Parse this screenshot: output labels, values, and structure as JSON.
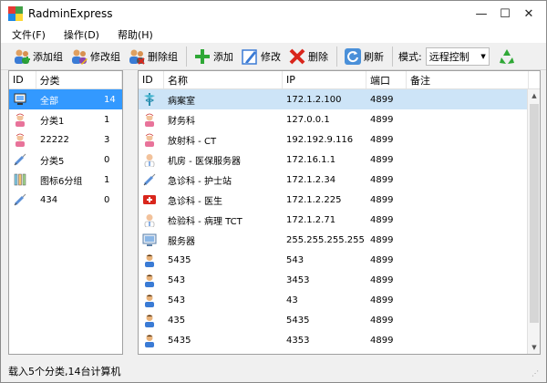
{
  "window": {
    "title": "RadminExpress"
  },
  "menu": [
    "文件(F)",
    "操作(D)",
    "帮助(H)"
  ],
  "toolbar": {
    "add_group": "添加组",
    "edit_group": "修改组",
    "delete_group": "删除组",
    "add": "添加",
    "edit": "修改",
    "delete": "删除",
    "refresh": "刷新",
    "mode_label": "模式:",
    "mode_value": "远程控制"
  },
  "groups": {
    "headers": [
      "ID",
      "分类"
    ],
    "rows": [
      {
        "name": "全部",
        "count": "14",
        "icon": "computer-group-icon"
      },
      {
        "name": "分类1",
        "count": "1",
        "icon": "nurse-icon"
      },
      {
        "name": "22222",
        "count": "3",
        "icon": "nurse-icon"
      },
      {
        "name": "分类5",
        "count": "0",
        "icon": "syringe-icon"
      },
      {
        "name": "图标6分组",
        "count": "1",
        "icon": "test-tubes-icon"
      },
      {
        "name": "434",
        "count": "0",
        "icon": "syringe-icon"
      }
    ]
  },
  "computers": {
    "headers": [
      "ID",
      "名称",
      "IP",
      "端口",
      "备注"
    ],
    "rows": [
      {
        "name": "病案室",
        "ip": "172.1.2.100",
        "port": "4899",
        "note": "",
        "icon": "caduceus-icon"
      },
      {
        "name": "财务科",
        "ip": "127.0.0.1",
        "port": "4899",
        "note": "",
        "icon": "nurse-icon"
      },
      {
        "name": "放射科 - CT",
        "ip": "192.192.9.116",
        "port": "4899",
        "note": "",
        "icon": "nurse-icon"
      },
      {
        "name": "机房 - 医保服务器",
        "ip": "172.16.1.1",
        "port": "4899",
        "note": "",
        "icon": "doctor-icon"
      },
      {
        "name": "急诊科 - 护士站",
        "ip": "172.1.2.34",
        "port": "4899",
        "note": "",
        "icon": "syringe-icon"
      },
      {
        "name": "急诊科 - 医生",
        "ip": "172.1.2.225",
        "port": "4899",
        "note": "",
        "icon": "first-aid-icon"
      },
      {
        "name": "检验科 - 病理 TCT",
        "ip": "172.1.2.71",
        "port": "4899",
        "note": "",
        "icon": "doctor-icon"
      },
      {
        "name": "服务器",
        "ip": "255.255.255.255",
        "port": "4899",
        "note": "",
        "icon": "server-icon"
      },
      {
        "name": "5435",
        "ip": "543",
        "port": "4899",
        "note": "",
        "icon": "person-icon"
      },
      {
        "name": "543",
        "ip": "3453",
        "port": "4899",
        "note": "",
        "icon": "person-icon"
      },
      {
        "name": "543",
        "ip": "43",
        "port": "4899",
        "note": "",
        "icon": "person-icon"
      },
      {
        "name": "435",
        "ip": "5435",
        "port": "4899",
        "note": "",
        "icon": "person-icon"
      },
      {
        "name": "5435",
        "ip": "4353",
        "port": "4899",
        "note": "",
        "icon": "person-icon"
      }
    ]
  },
  "status": {
    "text": "载入5个分类,14台计算机"
  },
  "colors": {
    "selection": "#3399ff",
    "row_highlight": "#cde4f7",
    "accent_green": "#2fa836",
    "delete_red": "#d9261c"
  }
}
